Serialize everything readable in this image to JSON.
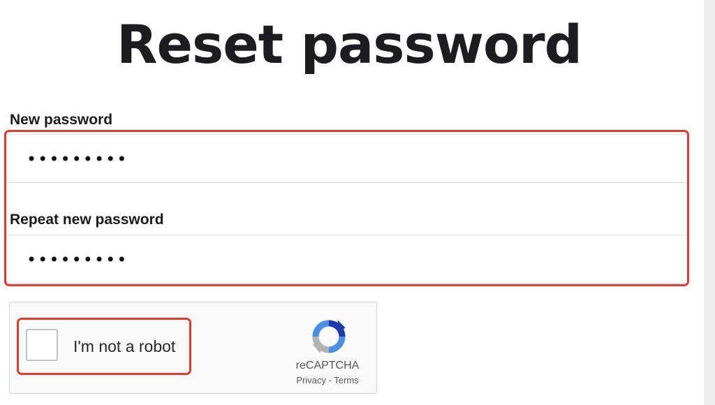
{
  "page": {
    "title": "Reset password"
  },
  "form": {
    "new_password": {
      "label": "New password",
      "value": "•••••••••"
    },
    "repeat_password": {
      "label": "Repeat new password",
      "value": "•••••••••"
    }
  },
  "recaptcha": {
    "checkbox_label": "I'm not a robot",
    "brand": "reCAPTCHA",
    "privacy_link": "Privacy",
    "separator": " - ",
    "terms_link": "Terms",
    "icon": "recaptcha-logo-icon"
  },
  "colors": {
    "highlight": "#e23a2e",
    "recaptcha_blue": "#1c3aa9",
    "recaptcha_lightblue": "#4a90e2",
    "recaptcha_gray": "#b3b3b3"
  }
}
